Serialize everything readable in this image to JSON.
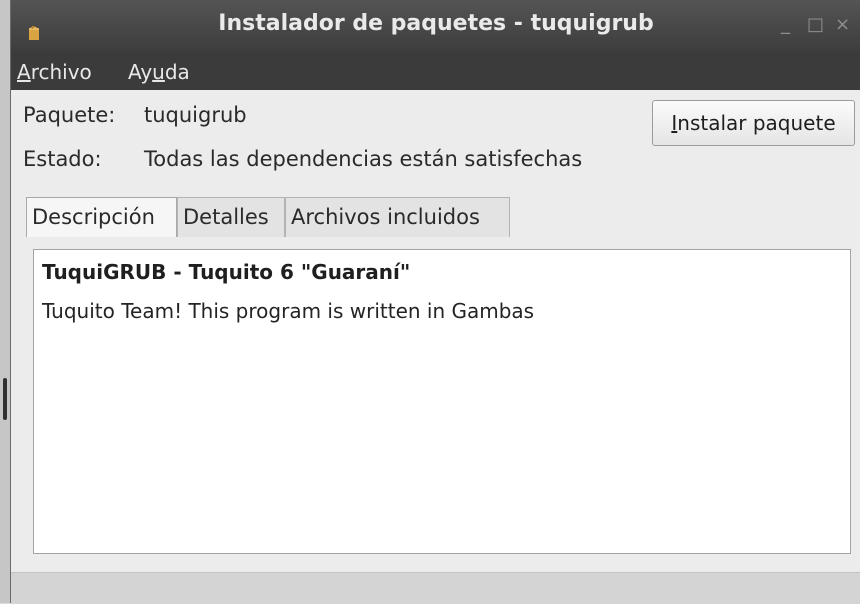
{
  "window": {
    "title": "Instalador de paquetes - tuquigrub",
    "controls": {
      "minimize": "_",
      "maximize": "□",
      "close": "×"
    }
  },
  "menu": {
    "archivo": {
      "mnemonic": "A",
      "rest": "rchivo"
    },
    "ayuda": {
      "before": "Ay",
      "mnemonic": "u",
      "after": "da"
    }
  },
  "package": {
    "name_label": "Paquete:",
    "name_value": "tuquigrub",
    "status_label": "Estado:",
    "status_value": "Todas las dependencias están satisfechas"
  },
  "install_button": {
    "mnemonic": "I",
    "rest": "nstalar paquete"
  },
  "tabs": [
    {
      "label": "Descripción",
      "active": true
    },
    {
      "label": "Detalles",
      "active": false
    },
    {
      "label": "Archivos incluidos",
      "active": false
    }
  ],
  "description": {
    "title": "TuquiGRUB - Tuquito 6 \"Guaraní\"",
    "text": "Tuquito Team! This program is written in Gambas"
  },
  "icons": {
    "app": "package-icon"
  },
  "colors": {
    "titlebar": "#4a4a4a",
    "menubar": "#3b3b3b",
    "app_icon": "#d9a441"
  }
}
